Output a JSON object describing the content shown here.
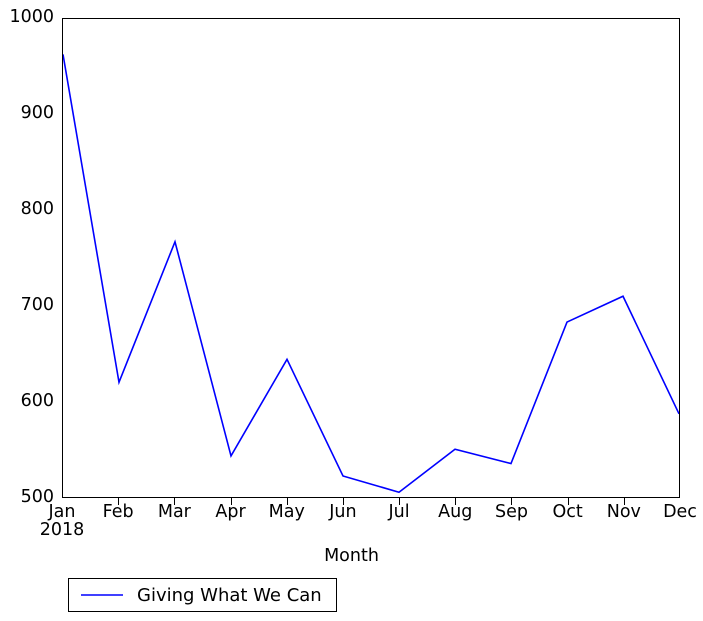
{
  "chart_data": {
    "type": "line",
    "title": "",
    "xlabel": "Month",
    "ylabel": "",
    "categories": [
      "Jan",
      "Feb",
      "Mar",
      "Apr",
      "May",
      "Jun",
      "Jul",
      "Aug",
      "Sep",
      "Oct",
      "Nov",
      "Dec"
    ],
    "x_axis_year": "2018",
    "series": [
      {
        "name": "Giving What We Can",
        "color": "#0000ff",
        "values": [
          963,
          620,
          767,
          543,
          644,
          522,
          505,
          550,
          535,
          683,
          710,
          587
        ]
      }
    ],
    "ylim": [
      500,
      1000
    ],
    "ytick_labels": [
      "500",
      "600",
      "700",
      "800",
      "900",
      "1000"
    ],
    "ytick_values": [
      500,
      600,
      700,
      800,
      900,
      1000
    ],
    "grid": false,
    "legend_position": "below-axes-left",
    "legend_entries": [
      {
        "label": "Giving What We Can",
        "color": "#0000ff"
      }
    ]
  },
  "axis": {
    "frame_color": "#000000"
  }
}
